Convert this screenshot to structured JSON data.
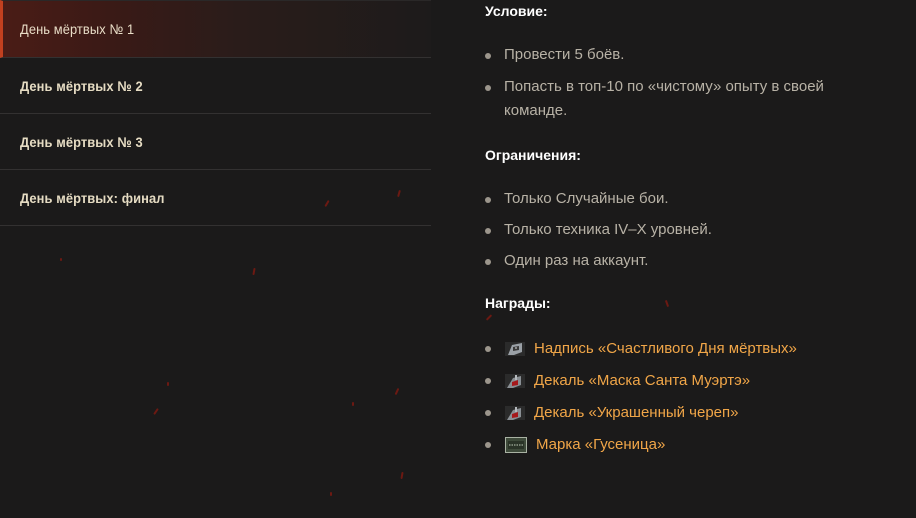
{
  "sidebar": {
    "items": [
      {
        "label": "День мёртвых № 1",
        "active": true
      },
      {
        "label": "День мёртвых № 2",
        "active": false
      },
      {
        "label": "День мёртвых № 3",
        "active": false
      },
      {
        "label": "День мёртвых: финал",
        "active": false
      }
    ]
  },
  "conditions": {
    "title": "Условие:",
    "items": [
      "Провести 5 боёв.",
      "Попасть в топ-10 по «чистому» опыту в своей команде."
    ]
  },
  "restrictions": {
    "title": "Ограничения:",
    "items": [
      "Только Случайные бои.",
      "Только техника IV–X уровней.",
      "Один раз на аккаунт."
    ]
  },
  "rewards": {
    "title": "Награды:",
    "items": [
      {
        "label": "Надпись «Счастливого Дня мёртвых»",
        "icon": "inscription-icon"
      },
      {
        "label": "Декаль «Маска Санта Муэртэ»",
        "icon": "decal-icon"
      },
      {
        "label": "Декаль «Украшенный череп»",
        "icon": "decal-icon"
      },
      {
        "label": "Марка «Гусеница»",
        "icon": "emblem-icon"
      }
    ]
  },
  "colors": {
    "background": "#1b1a1a",
    "accent": "#c2401f",
    "link": "#f1a648",
    "sidebar_text": "#e6dcc3"
  }
}
